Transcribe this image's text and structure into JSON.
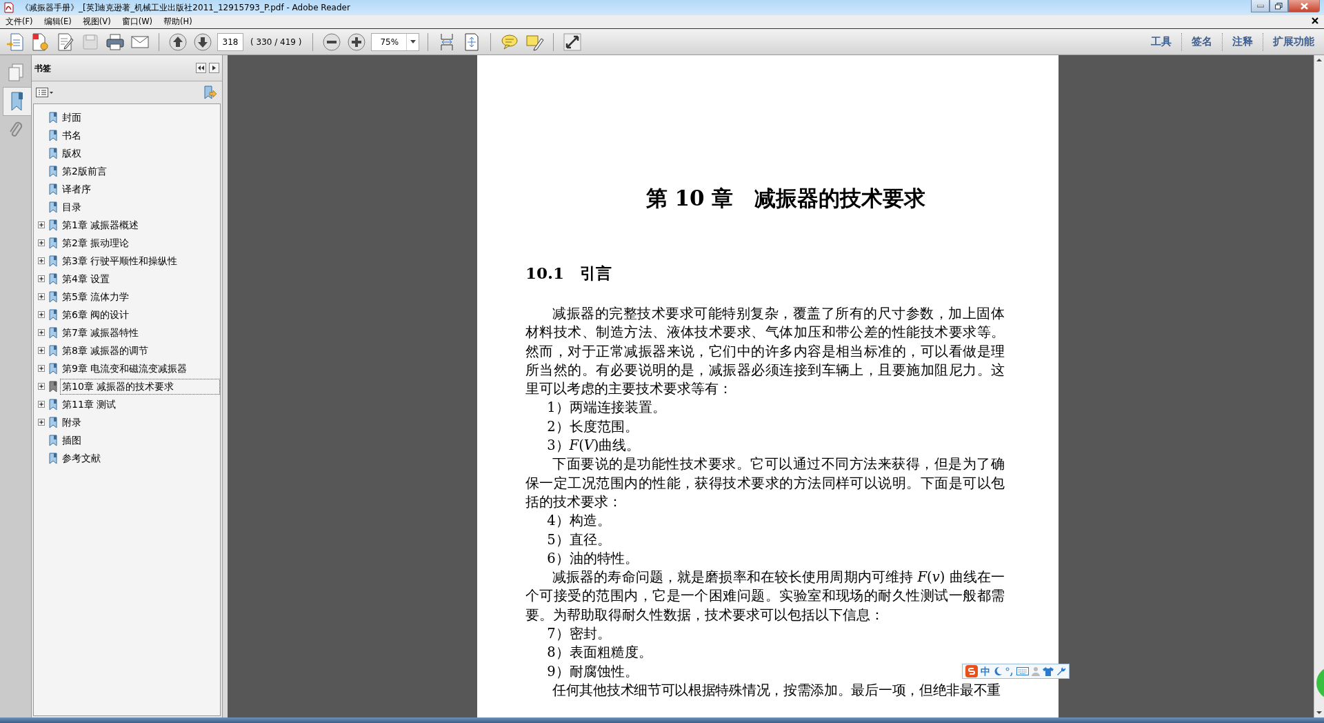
{
  "window": {
    "title": "《减振器手册》_[英]迪克逊著_机械工业出版社2011_12915793_P.pdf - Adobe Reader"
  },
  "menu": [
    "文件(F)",
    "编辑(E)",
    "视图(V)",
    "窗口(W)",
    "帮助(H)"
  ],
  "toolbar": {
    "page_number": "318",
    "page_count": "( 330 / 419 )",
    "zoom": "75%",
    "task_buttons": [
      "工具",
      "签名",
      "注释",
      "扩展功能"
    ]
  },
  "sidebar": {
    "title": "书签",
    "bookmarks": [
      {
        "label": "封面",
        "expandable": false,
        "selected": false
      },
      {
        "label": "书名",
        "expandable": false,
        "selected": false
      },
      {
        "label": "版权",
        "expandable": false,
        "selected": false
      },
      {
        "label": "第2版前言",
        "expandable": false,
        "selected": false
      },
      {
        "label": "译者序",
        "expandable": false,
        "selected": false
      },
      {
        "label": "目录",
        "expandable": false,
        "selected": false
      },
      {
        "label": "第1章 减振器概述",
        "expandable": true,
        "selected": false
      },
      {
        "label": "第2章 振动理论",
        "expandable": true,
        "selected": false
      },
      {
        "label": "第3章 行驶平顺性和操纵性",
        "expandable": true,
        "selected": false
      },
      {
        "label": "第4章 设置",
        "expandable": true,
        "selected": false
      },
      {
        "label": "第5章 流体力学",
        "expandable": true,
        "selected": false
      },
      {
        "label": "第6章 阀的设计",
        "expandable": true,
        "selected": false
      },
      {
        "label": "第7章 减振器特性",
        "expandable": true,
        "selected": false
      },
      {
        "label": "第8章 减振器的调节",
        "expandable": true,
        "selected": false
      },
      {
        "label": "第9章 电流变和磁流变减振器",
        "expandable": true,
        "selected": false
      },
      {
        "label": "第10章 减振器的技术要求",
        "expandable": true,
        "selected": true
      },
      {
        "label": "第11章 测试",
        "expandable": true,
        "selected": false
      },
      {
        "label": "附录",
        "expandable": true,
        "selected": false
      },
      {
        "label": "插图",
        "expandable": false,
        "selected": false
      },
      {
        "label": "参考文献",
        "expandable": false,
        "selected": false
      }
    ]
  },
  "document": {
    "chapter_title": "第 10 章　减振器的技术要求",
    "section_title": "10.1　引言",
    "blocks": [
      {
        "kind": "para",
        "text": "减振器的完整技术要求可能特别复杂，覆盖了所有的尺寸参数，加上固体材料技术、制造方法、液体技术要求、气体加压和带公差的性能技术要求等。然而，对于正常减振器来说，它们中的许多内容是相当标准的，可以看做是理所当然的。有必要说明的是，减振器必须连接到车辆上，且要施加阻尼力。这里可以考虑的主要技术要求等有："
      },
      {
        "kind": "item",
        "text": "1）两端连接装置。"
      },
      {
        "kind": "item",
        "text": "2）长度范围。"
      },
      {
        "kind": "item",
        "text": "3）*F*(*V*)曲线。"
      },
      {
        "kind": "para",
        "text": "下面要说的是功能性技术要求。它可以通过不同方法来获得，但是为了确保一定工况范围内的性能，获得技术要求的方法同样可以说明。下面是可以包括的技术要求："
      },
      {
        "kind": "item",
        "text": "4）构造。"
      },
      {
        "kind": "item",
        "text": "5）直径。"
      },
      {
        "kind": "item",
        "text": "6）油的特性。"
      },
      {
        "kind": "para",
        "text": "减振器的寿命问题，就是磨损率和在较长使用周期内可维持 *F*(*v*) 曲线在一个可接受的范围内，它是一个困难问题。实验室和现场的耐久性测试一般都需要。为帮助取得耐久性数据，技术要求可以包括以下信息："
      },
      {
        "kind": "item",
        "text": "7）密封。"
      },
      {
        "kind": "item",
        "text": "8）表面粗糙度。"
      },
      {
        "kind": "item",
        "text": "9）耐腐蚀性。"
      },
      {
        "kind": "para",
        "text": "任何其他技术细节可以根据特殊情况，按需添加。最后一项，但绝非最不重"
      }
    ]
  },
  "ime_toolbar": {
    "mode": "中"
  }
}
